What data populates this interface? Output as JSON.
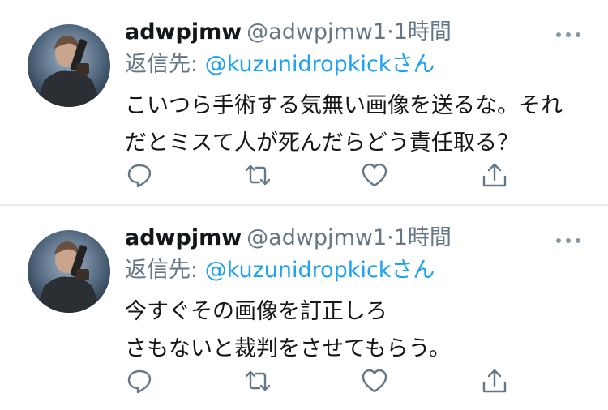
{
  "tweets": [
    {
      "display_name": "adwpjmw",
      "handle": "@adwpjmw1",
      "separator": "·",
      "time": "1時間",
      "reply_prefix": "返信先: ",
      "reply_to": "@kuzunidropkick",
      "reply_suffix": "さん",
      "body_lines": [
        "こいつら手術する気無い画像を送るな。それ",
        "だとミスて人が死んだらどう責任取る？"
      ]
    },
    {
      "display_name": "adwpjmw",
      "handle": "@adwpjmw1",
      "separator": "·",
      "time": "1時間",
      "reply_prefix": "返信先: ",
      "reply_to": "@kuzunidropkick",
      "reply_suffix": "さん",
      "body_lines": [
        "今すぐその画像を訂正しろ",
        "さもないと裁判をさせてもらう。"
      ]
    }
  ],
  "icons": {
    "reply": "reply-icon",
    "retweet": "retweet-icon",
    "like": "heart-icon",
    "share": "share-icon",
    "more": "more-icon"
  },
  "colors": {
    "link": "#1da1f2",
    "secondary_text": "#657786",
    "icon": "#657786",
    "divider": "#e6ecf0"
  }
}
